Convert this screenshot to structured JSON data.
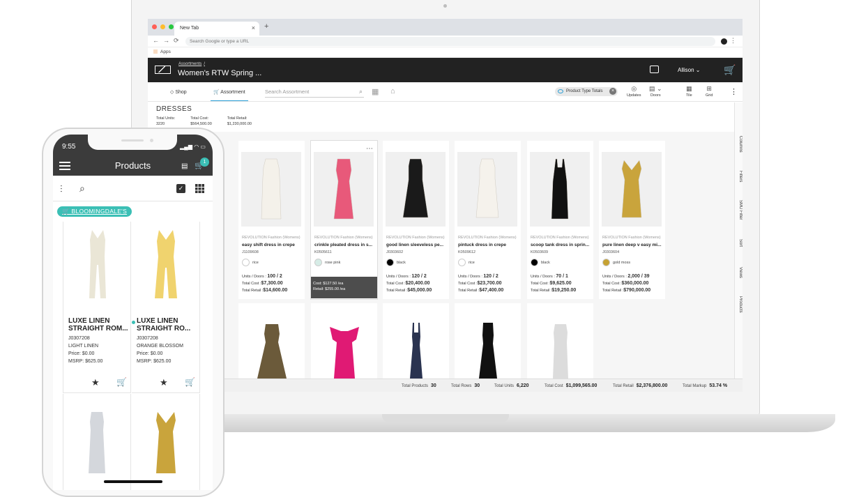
{
  "browser": {
    "tab_title": "New Tab",
    "tab_close": "×",
    "new_tab": "+",
    "url_placeholder": "Search Google or type a URL",
    "bookmarks_label": "Apps"
  },
  "app": {
    "breadcrumb": "Assortments",
    "breadcrumb_sep": "/",
    "title": "Women's RTW Spring ...",
    "user": "Allison"
  },
  "toolbar": {
    "shop": "Shop",
    "assortment": "Assortment",
    "search_placeholder": "Search Assortment",
    "pill": "Product Type Totals",
    "updates": "Updates",
    "doors": "Doors",
    "tile": "Tile",
    "grid": "Grid"
  },
  "section": {
    "title": "DRESSES",
    "total_units_label": "Total Units:",
    "total_units": "3220",
    "total_cost_label": "Total Cost:",
    "total_cost": "$564,500.00",
    "total_retail_label": "Total Retail:",
    "total_retail": "$1,230,000.00"
  },
  "sidebar": [
    "Columns",
    "Filters",
    "SMU Filter",
    "Sort",
    "Views",
    "Products"
  ],
  "labels": {
    "units_doors": "Units / Doors :",
    "total_cost": "Total Cost :",
    "total_retail": "Total Retail :"
  },
  "products": [
    {
      "brand": "REVOLUTION Fashion (Womens)",
      "name": "easy shift dress in crepe",
      "sku": "J1109608",
      "color": "rice",
      "swatch": "#ffffff",
      "dress": "#f4f1ea",
      "units": "100 / 2",
      "cost": "$7,300.00",
      "retail": "$14,600.00"
    },
    {
      "brand": "REVOLUTION Fashion (Womens)",
      "name": "crinkle pleated dress in s...",
      "sku": "K0505611",
      "color": "rose pink",
      "swatch": "#d6ece6",
      "dress": "#e8597a",
      "hover_cost": "Cost: $127.50 /ea",
      "hover_retail": "Retail: $255.00 /ea"
    },
    {
      "brand": "REVOLUTION Fashion (Womens)",
      "name": "good linen sleeveless pe...",
      "sku": "J0303602",
      "color": "black",
      "swatch": "#000000",
      "dress": "#1a1a1a",
      "units": "120 / 2",
      "cost": "$20,400.00",
      "retail": "$45,000.00"
    },
    {
      "brand": "REVOLUTION Fashion (Womens)",
      "name": "pintuck dress in crepe",
      "sku": "K0509612",
      "color": "rice",
      "swatch": "#ffffff",
      "dress": "#f5f2ec",
      "units": "120 / 2",
      "cost": "$23,700.00",
      "retail": "$47,400.00"
    },
    {
      "brand": "REVOLUTION Fashion (Womens)",
      "name": "scoop tank dress in sprin...",
      "sku": "K0503609",
      "color": "black",
      "swatch": "#000000",
      "dress": "#111111",
      "units": "70 / 1",
      "cost": "$9,625.00",
      "retail": "$19,250.00"
    },
    {
      "brand": "REVOLUTION Fashion (Womens)",
      "name": "pure linen deep v easy mi...",
      "sku": "J0303604",
      "color": "gold moss",
      "swatch": "#c6a233",
      "dress": "#c9a43c",
      "units": "2,000 / 39",
      "cost": "$360,000.00",
      "retail": "$790,000.00"
    }
  ],
  "row2_colors": [
    "#6b5a3a",
    "#e01a74",
    "#2a3350",
    "#111111",
    "#dcdcdc"
  ],
  "footer": {
    "total_products_label": "Total Products",
    "total_products": "30",
    "total_rows_label": "Total Rows",
    "total_rows": "30",
    "total_units_label": "Total Units",
    "total_units": "6,220",
    "total_cost_label": "Total Cost",
    "total_cost": "$1,099,565.00",
    "total_retail_label": "Total Retail",
    "total_retail": "$2,376,800.00",
    "total_markup_label": "Total Markup",
    "total_markup": "53.74 %"
  },
  "phone": {
    "time": "9:55",
    "title": "Products",
    "cart_badge": "1",
    "store_tag": "BLOOMINGDALE'S",
    "items": [
      {
        "name": "LUXE LINEN STRAIGHT ROM...",
        "sku": "J0307208",
        "color": "LIGHT LINEN",
        "price": "Price: $0.00",
        "msrp": "MSRP: $625.00",
        "dress": "#eae6d6"
      },
      {
        "name": "LUXE LINEN STRAIGHT RO...",
        "sku": "J0307208",
        "color": "ORANGE BLOSSOM",
        "price": "Price: $0.00",
        "msrp": "MSRP: $625.00",
        "dress": "#f0d36e"
      }
    ],
    "row2_colors": [
      "#d4d7dc",
      "#c9a43c"
    ]
  },
  "colors": {
    "accent": "#2a9fd6",
    "teal": "#3bbfb5",
    "header": "#222222"
  }
}
